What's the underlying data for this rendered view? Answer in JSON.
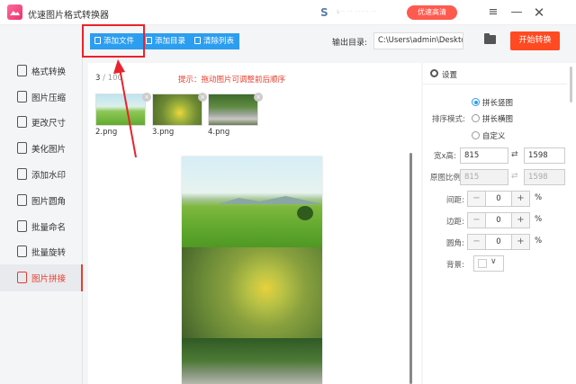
{
  "window": {
    "title": "优速图片格式转换器",
    "promo_icon": "S",
    "promo_text": "s·· ·· ····· ··",
    "promo_button": "优速高清",
    "menu_icon": "≡",
    "min_icon": "—",
    "close_icon": "✕"
  },
  "sidebar": {
    "items": [
      {
        "label": "格式转换"
      },
      {
        "label": "图片压缩"
      },
      {
        "label": "更改尺寸"
      },
      {
        "label": "美化图片"
      },
      {
        "label": "添加水印"
      },
      {
        "label": "图片圆角"
      },
      {
        "label": "批量命名"
      },
      {
        "label": "批量旋转"
      },
      {
        "label": "图片拼接"
      }
    ],
    "active_index": 8
  },
  "toolbar": {
    "add_file": "添加文件",
    "add_folder": "添加目录",
    "clear_list": "清除列表",
    "output_label": "输出目录:",
    "output_path": "C:\\Users\\admin\\Deskto",
    "start": "开始转换"
  },
  "main": {
    "count_current": "3",
    "count_total": " / 100",
    "hint": "提示：拖动图片可调整前后顺序",
    "files": [
      {
        "name": "2.png"
      },
      {
        "name": "3.png"
      },
      {
        "name": "4.png"
      }
    ],
    "close_glyph": "×"
  },
  "settings": {
    "title": "设置",
    "sort_label": "排序模式:",
    "sort_options": [
      "拼长竖图",
      "拼长横图",
      "自定义"
    ],
    "sort_selected": "拼长竖图",
    "size_label": "宽x高:",
    "width": "815",
    "height": "1598",
    "ratio_label": "原图比例:",
    "ratio_w": "815",
    "ratio_h": "1598",
    "spacing_label": "间距:",
    "spacing": "0",
    "border_label": "边距:",
    "border": "0",
    "radius_label": "圆角:",
    "radius": "0",
    "unit": "%",
    "background_label": "背景:",
    "background_color": "#ffffff",
    "minus": "−",
    "plus": "+",
    "swap_icon": "⇄",
    "chevron": "∨"
  },
  "colors": {
    "accent": "#2c9ef0",
    "start_button": "#ff4a22",
    "hint": "#e53e2f",
    "annotation": "#e8232b"
  }
}
